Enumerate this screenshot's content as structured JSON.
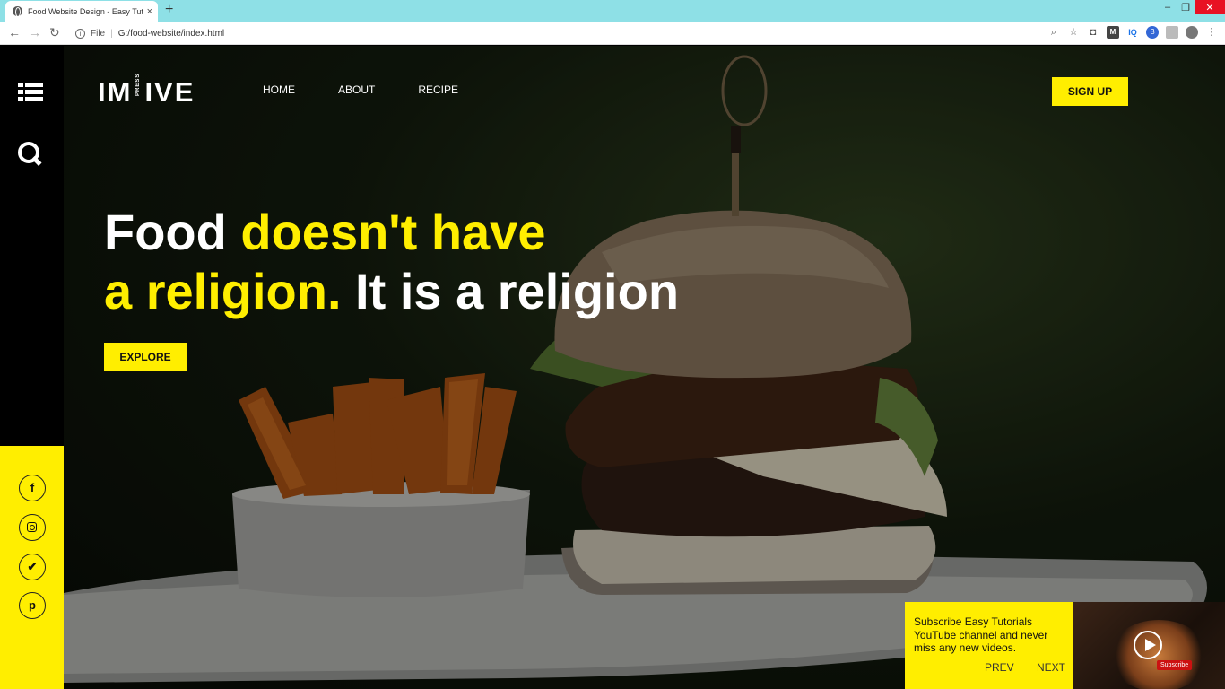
{
  "browser": {
    "tab_title": "Food Website Design - Easy Tutori",
    "tab_close": "×",
    "new_tab": "+",
    "url_scheme": "File",
    "url": "G:/food-website/index.html"
  },
  "site": {
    "logo": {
      "left": "IM",
      "press": "PRESS",
      "right": "IVE"
    },
    "nav": [
      "HOME",
      "ABOUT",
      "RECIPE"
    ],
    "signup_label": "SIGN UP",
    "headline": {
      "line1_white": "Food ",
      "line1_yellow": "doesn't have",
      "line2_yellow": "a religion.",
      "line2_white": " It is a religion"
    },
    "explore_label": "EXPLORE",
    "social": [
      {
        "name": "facebook",
        "glyph": "f"
      },
      {
        "name": "instagram",
        "glyph": ""
      },
      {
        "name": "twitter",
        "glyph": "🐦"
      },
      {
        "name": "pinterest",
        "glyph": "p"
      }
    ],
    "subscribe": {
      "message": "Subscribe Easy Tutorials YouTube channel and never miss any new videos.",
      "prev_label": "PREV",
      "next_label": "NEXT",
      "video_button": "Subscribe"
    }
  },
  "colors": {
    "accent": "#ffee00",
    "sidebar": "#000000",
    "tabbar": "#8ee0e6"
  }
}
